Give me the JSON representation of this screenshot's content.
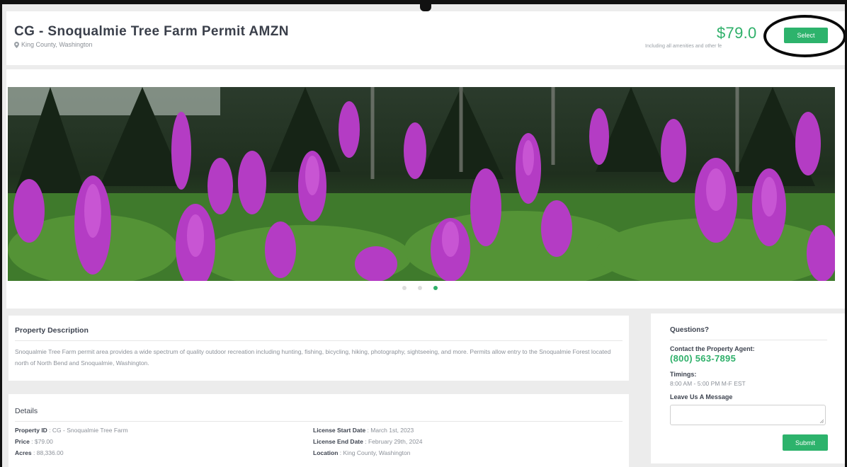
{
  "header": {
    "title": "CG - Snoqualmie Tree Farm Permit AMZN",
    "location": "King County, Washington",
    "price": "$79.0",
    "price_note": "Including all amenities and other fe",
    "select_label": "Select"
  },
  "gallery": {
    "image": "purple fireweed flowers in front of a forest",
    "slides": 3,
    "active_slide": 3
  },
  "description": {
    "title": "Property Description",
    "text": "Snoqualmie Tree Farm permit area provides a wide spectrum of quality outdoor recreation including hunting, fishing, bicycling, hiking, photography, sightseeing, and more. Permits allow entry to the Snoqualmie Forest located north of North Bend and Snoqualmie, Washington."
  },
  "details": {
    "title": "Details",
    "items": [
      {
        "label": "Property ID",
        "value": "CG - Snoqualmie Tree Farm"
      },
      {
        "label": "License Start Date",
        "value": "March 1st, 2023"
      },
      {
        "label": "Price",
        "value": "$79.00"
      },
      {
        "label": "License End Date",
        "value": "February 29th, 2024"
      },
      {
        "label": "Acres",
        "value": "88,336.00"
      },
      {
        "label": "Location",
        "value": "King County, Washington"
      }
    ]
  },
  "questions": {
    "title": "Questions?",
    "contact_label": "Contact the Property Agent:",
    "phone": "(800) 563-7895",
    "timings_label": "Timings:",
    "timings_value": "8:00 AM - 5:00 PM M-F EST",
    "message_label": "Leave Us A Message",
    "submit_label": "Submit"
  },
  "colors": {
    "accent_green": "#2db36c",
    "flower_purple": "#b43cc4",
    "annotation": "#0a0a0a"
  }
}
